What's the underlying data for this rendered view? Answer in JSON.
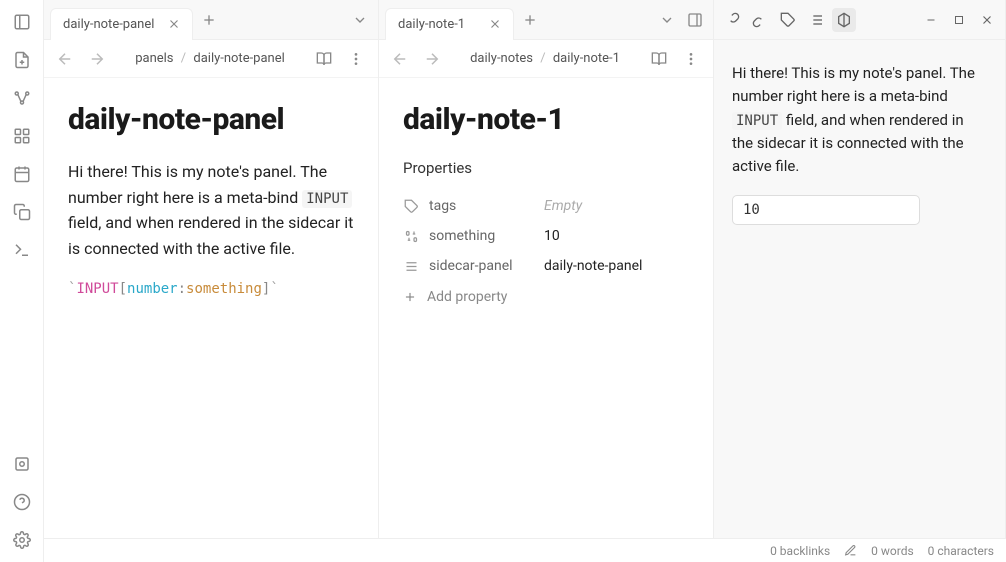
{
  "tabs": {
    "pane_a": {
      "title": "daily-note-panel"
    },
    "pane_b": {
      "title": "daily-note-1"
    }
  },
  "pane_a": {
    "breadcrumb": {
      "parent": "panels",
      "current": "daily-note-panel"
    },
    "title": "daily-note-panel",
    "body_pre": "Hi there!  This is my note's panel.  The number right here is a meta-bind ",
    "body_code": "INPUT",
    "body_post": " field, and when rendered in the sidecar it is connected with the active file.",
    "code": {
      "kw": "INPUT",
      "type": "number",
      "name": "something"
    }
  },
  "pane_b": {
    "breadcrumb": {
      "parent": "daily-notes",
      "current": "daily-note-1"
    },
    "title": "daily-note-1",
    "properties_label": "Properties",
    "properties": [
      {
        "key": "tags",
        "val": "",
        "empty": "Empty",
        "icon": "tag"
      },
      {
        "key": "something",
        "val": "10",
        "icon": "binary"
      },
      {
        "key": "sidecar-panel",
        "val": "daily-note-panel",
        "icon": "list"
      }
    ],
    "add_property_label": "Add property"
  },
  "sidecar": {
    "body_pre": "Hi there! This is my note's panel. The number right here is a meta-bind ",
    "body_code": "INPUT",
    "body_post": " field, and when rendered in the sidecar it is connected with the active file.",
    "input_value": "10"
  },
  "status": {
    "backlinks": "0 backlinks",
    "words": "0 words",
    "characters": "0 characters"
  }
}
